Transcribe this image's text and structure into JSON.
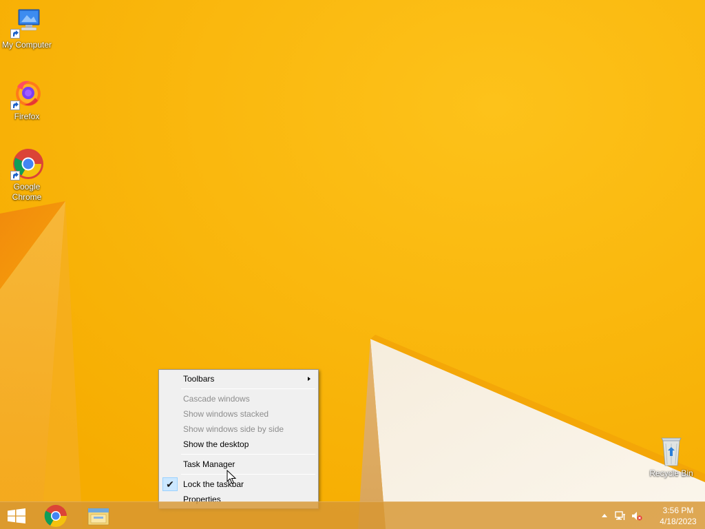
{
  "desktop": {
    "icons": [
      {
        "label": "My Computer",
        "icon": "computer-icon"
      },
      {
        "label": "Firefox",
        "icon": "firefox-icon"
      },
      {
        "label": "Google Chrome",
        "icon": "chrome-icon"
      },
      {
        "label": "Recycle Bin",
        "icon": "recycle-bin-icon"
      }
    ]
  },
  "context_menu": {
    "items": [
      {
        "label": "Toolbars",
        "enabled": true,
        "has_submenu": true
      },
      {
        "label": "Cascade windows",
        "enabled": false
      },
      {
        "label": "Show windows stacked",
        "enabled": false
      },
      {
        "label": "Show windows side by side",
        "enabled": false
      },
      {
        "label": "Show the desktop",
        "enabled": true
      },
      {
        "label": "Task Manager",
        "enabled": true
      },
      {
        "label": "Lock the taskbar",
        "enabled": true,
        "checked": true
      },
      {
        "label": "Properties",
        "enabled": true
      }
    ]
  },
  "taskbar": {
    "pinned": [
      {
        "icon": "chrome-icon"
      },
      {
        "icon": "file-explorer-icon"
      }
    ],
    "tray": {
      "icons": [
        "show-hidden-icons-arrow",
        "network-icon",
        "volume-muted-icon"
      ]
    },
    "clock": {
      "time": "3:56 PM",
      "date": "4/18/2023"
    }
  },
  "colors": {
    "wallpaper_bg": "#f8b100",
    "menu_bg": "#f0f0f0",
    "menu_check_highlight": "#cce8ff",
    "taskbar": "#d79632"
  }
}
